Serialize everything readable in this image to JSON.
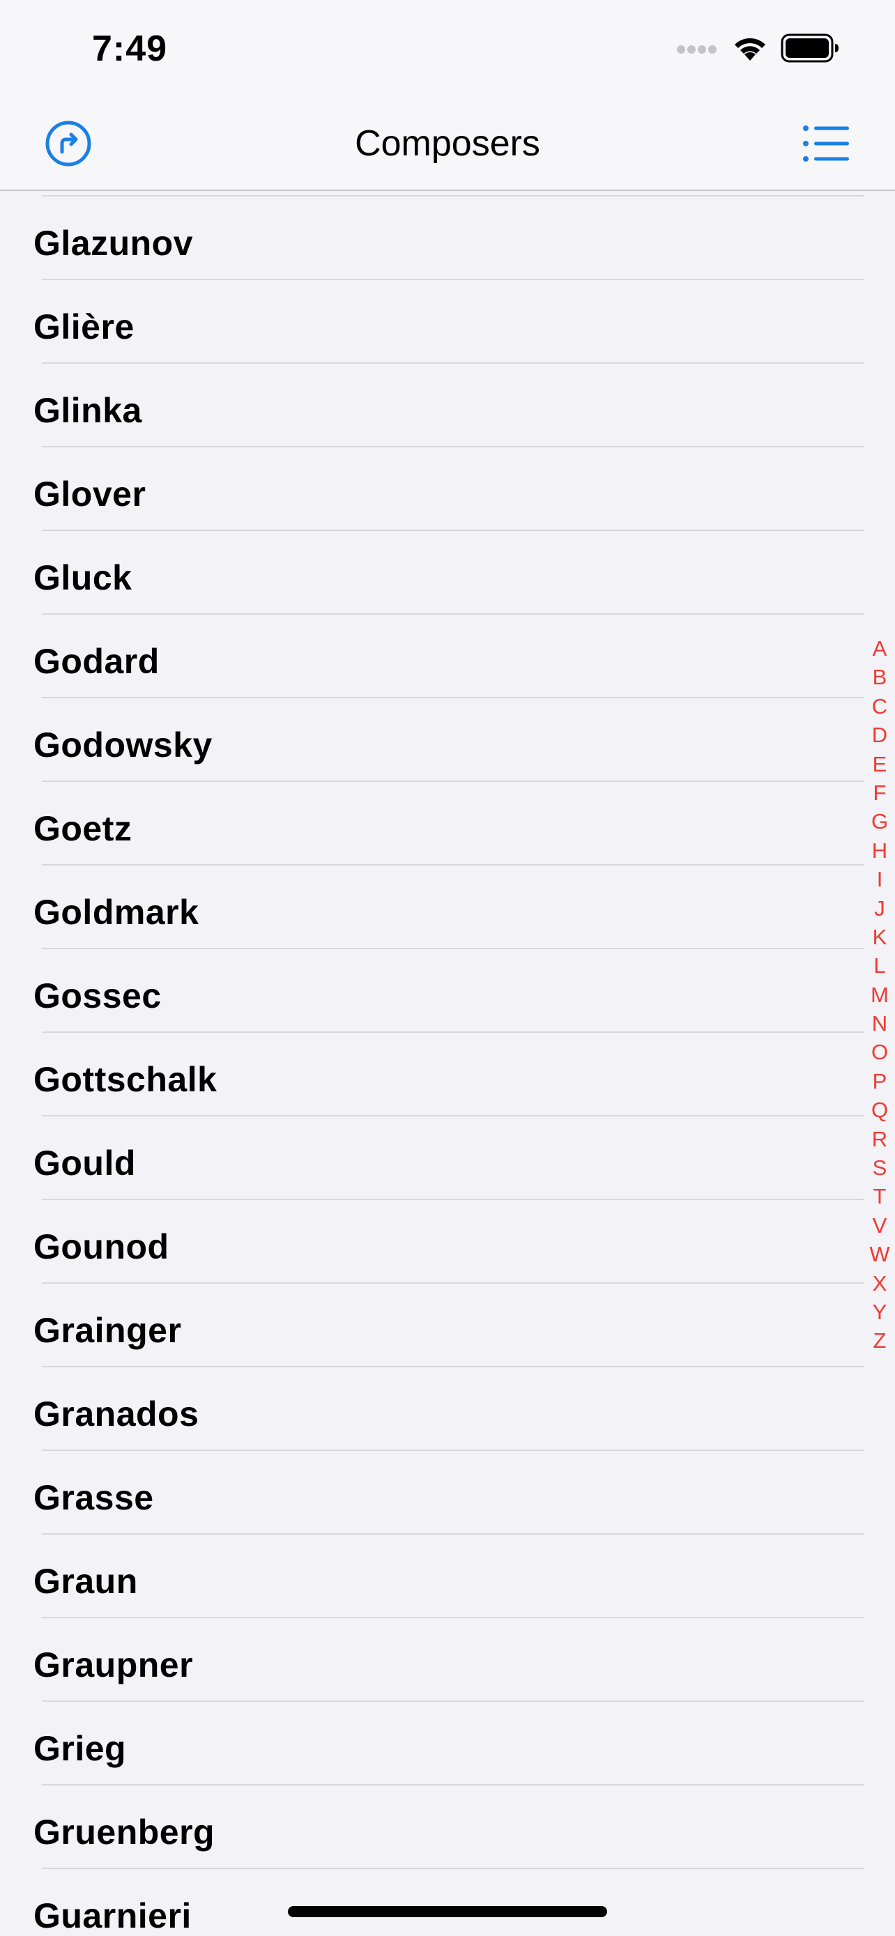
{
  "status_bar": {
    "time": "7:49"
  },
  "nav": {
    "title": "Composers",
    "left_icon": "share-forward-icon",
    "right_icon": "list-icon",
    "accent_color": "#1a7fe6"
  },
  "composers": [
    "Glazunov",
    "Glière",
    "Glinka",
    "Glover",
    "Gluck",
    "Godard",
    "Godowsky",
    "Goetz",
    "Goldmark",
    "Gossec",
    "Gottschalk",
    "Gould",
    "Gounod",
    "Grainger",
    "Granados",
    "Grasse",
    "Graun",
    "Graupner",
    "Grieg",
    "Gruenberg",
    "Guarnieri"
  ],
  "index_letters": [
    "A",
    "B",
    "C",
    "D",
    "E",
    "F",
    "G",
    "H",
    "I",
    "J",
    "K",
    "L",
    "M",
    "N",
    "O",
    "P",
    "Q",
    "R",
    "S",
    "T",
    "V",
    "W",
    "X",
    "Y",
    "Z"
  ],
  "index_color": "#ef3b32"
}
